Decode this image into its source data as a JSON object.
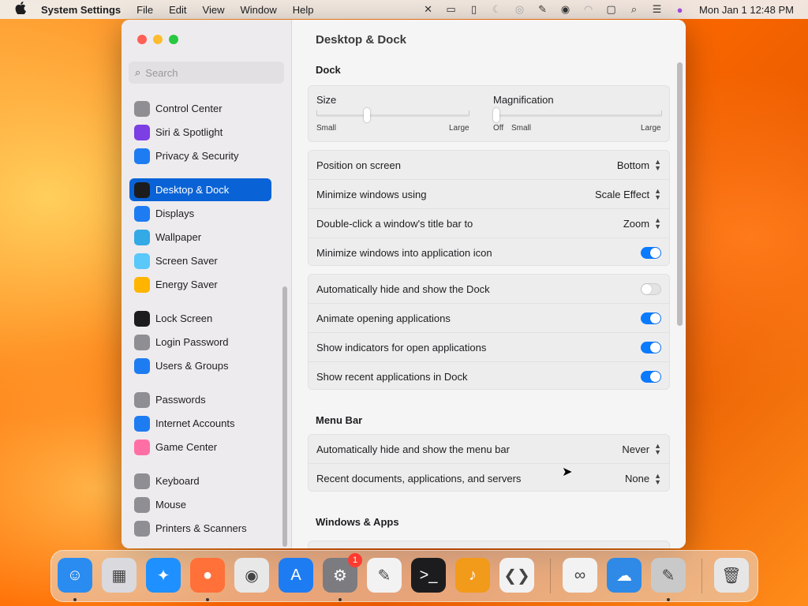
{
  "menubar": {
    "app_name": "System Settings",
    "menus": [
      "File",
      "Edit",
      "View",
      "Window",
      "Help"
    ],
    "clock": "Mon Jan 1  12:48 PM"
  },
  "search": {
    "placeholder": "Search"
  },
  "sidebar": {
    "items": [
      {
        "label": "Control Center",
        "icon": "control-center-icon",
        "color": "#8e8e93"
      },
      {
        "label": "Siri & Spotlight",
        "icon": "siri-icon",
        "color": "#7b3fe4"
      },
      {
        "label": "Privacy & Security",
        "icon": "hand-icon",
        "color": "#1e7cf2"
      },
      {
        "label": "Desktop & Dock",
        "icon": "dock-icon",
        "color": "#1c1c1e"
      },
      {
        "label": "Displays",
        "icon": "sun-icon",
        "color": "#1e7cf2"
      },
      {
        "label": "Wallpaper",
        "icon": "flower-icon",
        "color": "#33a9e6"
      },
      {
        "label": "Screen Saver",
        "icon": "screen-saver-icon",
        "color": "#5ac8fa"
      },
      {
        "label": "Energy Saver",
        "icon": "bulb-icon",
        "color": "#ffb400"
      },
      {
        "label": "Lock Screen",
        "icon": "lock-icon",
        "color": "#1c1c1e"
      },
      {
        "label": "Login Password",
        "icon": "lock-icon",
        "color": "#8e8e93"
      },
      {
        "label": "Users & Groups",
        "icon": "users-icon",
        "color": "#1e7cf2"
      },
      {
        "label": "Passwords",
        "icon": "key-icon",
        "color": "#8e8e93"
      },
      {
        "label": "Internet Accounts",
        "icon": "at-icon",
        "color": "#1e7cf2"
      },
      {
        "label": "Game Center",
        "icon": "game-center-icon",
        "color": "#ff6fa5"
      },
      {
        "label": "Keyboard",
        "icon": "keyboard-icon",
        "color": "#8e8e93"
      },
      {
        "label": "Mouse",
        "icon": "mouse-icon",
        "color": "#8e8e93"
      },
      {
        "label": "Printers & Scanners",
        "icon": "printer-icon",
        "color": "#8e8e93"
      }
    ],
    "active_index": 3
  },
  "content": {
    "title": "Desktop & Dock",
    "dock_section": "Dock",
    "size_label": "Size",
    "size_small": "Small",
    "size_large": "Large",
    "size_value": 0.33,
    "mag_label": "Magnification",
    "mag_off": "Off",
    "mag_small": "Small",
    "mag_large": "Large",
    "mag_value": 0.0,
    "rows_a": [
      {
        "label": "Position on screen",
        "value": "Bottom",
        "kind": "popup"
      },
      {
        "label": "Minimize windows using",
        "value": "Scale Effect",
        "kind": "popup"
      },
      {
        "label": "Double-click a window's title bar to",
        "value": "Zoom",
        "kind": "popup"
      },
      {
        "label": "Minimize windows into application icon",
        "value": "on",
        "kind": "toggle"
      }
    ],
    "rows_b": [
      {
        "label": "Automatically hide and show the Dock",
        "value": "off",
        "kind": "toggle"
      },
      {
        "label": "Animate opening applications",
        "value": "on",
        "kind": "toggle"
      },
      {
        "label": "Show indicators for open applications",
        "value": "on",
        "kind": "toggle"
      },
      {
        "label": "Show recent applications in Dock",
        "value": "on",
        "kind": "toggle"
      }
    ],
    "menubar_section": "Menu Bar",
    "rows_c": [
      {
        "label": "Automatically hide and show the menu bar",
        "value": "Never",
        "kind": "popup"
      },
      {
        "label": "Recent documents, applications, and servers",
        "value": "None",
        "kind": "popup"
      }
    ],
    "windows_section": "Windows & Apps"
  },
  "dock": {
    "apps": [
      {
        "name": "finder-icon",
        "glyph": "☺",
        "color": "#2a8cf0",
        "running": true
      },
      {
        "name": "launchpad-icon",
        "glyph": "▦",
        "color": "#d9d9de",
        "running": false
      },
      {
        "name": "safari-icon",
        "glyph": "✦",
        "color": "#1e90ff",
        "running": false
      },
      {
        "name": "firefox-icon",
        "glyph": "●",
        "color": "#ff7139",
        "running": true
      },
      {
        "name": "chrome-icon",
        "glyph": "◉",
        "color": "#e8e8e8",
        "running": false
      },
      {
        "name": "app-store-icon",
        "glyph": "A",
        "color": "#1e7cf2",
        "running": false
      },
      {
        "name": "system-settings-icon",
        "glyph": "⚙",
        "color": "#7c7c80",
        "running": true,
        "badge": "1"
      },
      {
        "name": "textedit-icon",
        "glyph": "✎",
        "color": "#f2f2f2",
        "running": false
      },
      {
        "name": "terminal-icon",
        "glyph": ">_",
        "color": "#1c1c1e",
        "running": false
      },
      {
        "name": "garageband-icon",
        "glyph": "♪",
        "color": "#f29a1a",
        "running": false
      },
      {
        "name": "vscode-icon",
        "glyph": "❮❯",
        "color": "#f2f2f2",
        "running": false
      },
      {
        "name": "visual-studio-icon",
        "glyph": "∞",
        "color": "#f2f2f2",
        "running": false
      },
      {
        "name": "weather-icon",
        "glyph": "☁",
        "color": "#2e8ae6",
        "running": false
      },
      {
        "name": "script-editor-icon",
        "glyph": "✎",
        "color": "#c9c9c9",
        "running": true
      },
      {
        "name": "trash-icon",
        "glyph": "🗑",
        "color": "#e6e6e6",
        "running": false
      }
    ]
  }
}
